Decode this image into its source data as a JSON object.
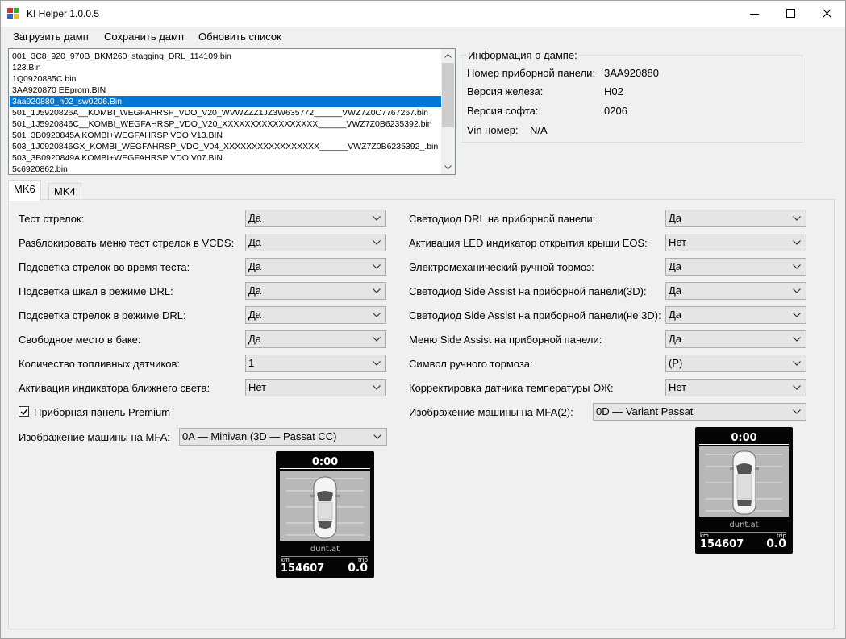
{
  "window": {
    "title": "KI Helper 1.0.0.5",
    "icon_name": "app-icon",
    "controls": [
      "minimize-icon",
      "maximize-icon",
      "close-icon"
    ]
  },
  "menu": {
    "items": [
      "Загрузить дамп",
      "Сохранить дамп",
      "Обновить список"
    ]
  },
  "files": {
    "items": [
      "001_3C8_920_970B_BKM260_stagging_DRL_114109.bin",
      "123.Bin",
      "1Q0920885C.bin",
      "3AA920870 EEprom.BIN",
      "3aa920880_h02_sw0206.Bin",
      "501_1J5920826A__KOMBI_WEGFAHRSP_VDO_V20_WVWZZZ1JZ3W635772______VWZ7Z0C7767267.bin",
      "501_1J5920846C__KOMBI_WEGFAHRSP_VDO_V20_XXXXXXXXXXXXXXXXX______VWZ7Z0B6235392.bin",
      "501_3B0920845A  KOMBI+WEGFAHRSP VDO V13.BIN",
      "503_1J0920846GX_KOMBI_WEGFAHRSP_VDO_V04_XXXXXXXXXXXXXXXXX______VWZ7Z0B6235392_.bin",
      "503_3B0920849A  KOMBI+WEGFAHRSP VDO V07.BIN",
      "5c6920862.bin"
    ],
    "selected_index": 4
  },
  "info": {
    "title": "Информация о дампе:",
    "panel_number_label": "Номер приборной панели:",
    "panel_number": "3AA920880",
    "hw_label": "Версия железа:",
    "hw": "H02",
    "sw_label": "Версия софта:",
    "sw": "0206",
    "vin_label": "Vin номер:",
    "vin": "N/A"
  },
  "tabs": [
    "MK6",
    "MK4"
  ],
  "left_settings": [
    {
      "label": "Тест стрелок:",
      "value": "Да"
    },
    {
      "label": "Разблокировать меню тест стрелок в VCDS:",
      "value": "Да"
    },
    {
      "label": "Подсветка стрелок во время теста:",
      "value": "Да"
    },
    {
      "label": "Подсветка шкал в режиме DRL:",
      "value": "Да"
    },
    {
      "label": "Подсветка стрелок в режиме DRL:",
      "value": "Да"
    },
    {
      "label": "Свободное место в баке:",
      "value": "Да"
    },
    {
      "label": "Количество топливных датчиков:",
      "value": "1"
    },
    {
      "label": "Активация индикатора ближнего света:",
      "value": "Нет"
    }
  ],
  "right_settings": [
    {
      "label": "Светодиод DRL на приборной панели:",
      "value": "Да"
    },
    {
      "label": "Активация LED индикатор открытия крыши EOS:",
      "value": "Нет"
    },
    {
      "label": "Электромеханический ручной тормоз:",
      "value": "Да"
    },
    {
      "label": "Светодиод Side Assist на приборной панели(3D):",
      "value": "Да"
    },
    {
      "label": "Светодиод Side Assist на приборной панели(не 3D):",
      "value": "Да"
    },
    {
      "label": "Меню Side Assist на приборной панели:",
      "value": "Да"
    },
    {
      "label": "Символ ручного тормоза:",
      "value": "(P)"
    },
    {
      "label": "Корректировка датчика температуры ОЖ:",
      "value": "Нет"
    }
  ],
  "premium": {
    "label": "Приборная панель Premium",
    "checked": true
  },
  "mfa": {
    "label": "Изображение машины на MFA:",
    "value": "0A — Minivan (3D — Passat CC)"
  },
  "mfa2": {
    "label": "Изображение машины на MFA(2):",
    "value": "0D — Variant Passat"
  },
  "cluster_left": {
    "time": "0:00",
    "brand": "dunt.at",
    "km_label": "km",
    "trip_label": "trip",
    "odometer": "154607",
    "trip": "0.0"
  },
  "cluster_right": {
    "time": "0:00",
    "brand": "dunt.at",
    "km_label": "km",
    "trip_label": "trip",
    "odometer": "154607",
    "trip": "0.0"
  },
  "colors": {
    "selection": "#0078d7",
    "window_bg": "#f0f0f0",
    "combo_bg": "#e5e5e5"
  }
}
